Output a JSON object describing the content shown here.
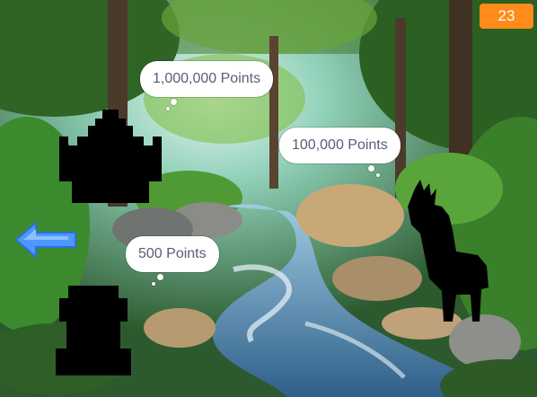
{
  "score": {
    "value": "23"
  },
  "bubbles": [
    {
      "label": "1,000,000 Points"
    },
    {
      "label": "100,000 Points"
    },
    {
      "label": "500 Points"
    }
  ],
  "colors": {
    "score_bg": "#ff8c1a",
    "arrow": "#4d97ff",
    "bubble_text": "#575e75"
  },
  "icons": {
    "nav": "left-arrow-icon"
  }
}
